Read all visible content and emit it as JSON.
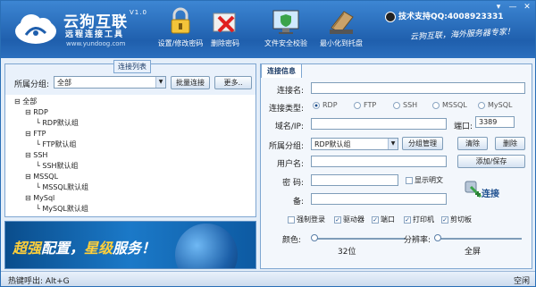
{
  "app": {
    "name": "云狗互联",
    "version": "V1.0",
    "subtitle": "远程连接工具",
    "url": "www.yundoog.com"
  },
  "toolbar": [
    {
      "label": "设置/修改密码",
      "icon": "lock-icon"
    },
    {
      "label": "删除密码",
      "icon": "delete-icon"
    },
    {
      "label": "文件安全校验",
      "icon": "monitor-shield-icon"
    },
    {
      "label": "最小化到托盘",
      "icon": "hdd-icon"
    }
  ],
  "support": "技术支持QQ:4008923331",
  "slogan": "云狗互联，海外服务器专家！",
  "window_controls": [
    "▾",
    "—",
    "✕"
  ],
  "left_panel": {
    "title": "连接列表",
    "group_label": "所属分组:",
    "group_value": "全部",
    "batch_button": "批量连接",
    "more_button": "更多..",
    "tree": [
      {
        "label": "全部",
        "level": 0
      },
      {
        "label": "RDP",
        "level": 1
      },
      {
        "label": "RDP默认组",
        "level": 2
      },
      {
        "label": "FTP",
        "level": 1
      },
      {
        "label": "FTP默认组",
        "level": 2
      },
      {
        "label": "SSH",
        "level": 1
      },
      {
        "label": "SSH默认组",
        "level": 2
      },
      {
        "label": "MSSQL",
        "level": 1
      },
      {
        "label": "MSSQL默认组",
        "level": 2
      },
      {
        "label": "MySql",
        "level": 1
      },
      {
        "label": "MySQL默认组",
        "level": 2
      }
    ]
  },
  "banner": {
    "part1": "超强",
    "part2": "配置，",
    "part3": "星级",
    "part4": "服务！"
  },
  "right_panel": {
    "tab": "连接信息",
    "name_label": "连接名:",
    "type_label": "连接类型:",
    "types": [
      "RDP",
      "FTP",
      "SSH",
      "MSSQL",
      "MySQL"
    ],
    "selected_type": "RDP",
    "host_label": "域名/IP:",
    "port_label": "端口:",
    "port_value": "3389",
    "group_label": "所属分组:",
    "group_value": "RDP默认组",
    "group_manage": "分组管理",
    "clear": "清除",
    "delete": "删除",
    "user_label": "用户名:",
    "add_save": "添加/保存",
    "pass_label": "密  码:",
    "show_plain": "显示明文",
    "remark_label": "备:",
    "connect": "连接",
    "options": [
      {
        "label": "强制登录",
        "checked": false
      },
      {
        "label": "驱动器",
        "checked": true
      },
      {
        "label": "端口",
        "checked": true
      },
      {
        "label": "打印机",
        "checked": true
      },
      {
        "label": "剪切板",
        "checked": true
      }
    ],
    "color_label": "颜色:",
    "color_value": "32位",
    "resolution_label": "分辨率:",
    "resolution_value": "全屏"
  },
  "status": {
    "hotkey": "热键呼出: Alt+G",
    "state": "空闲"
  }
}
